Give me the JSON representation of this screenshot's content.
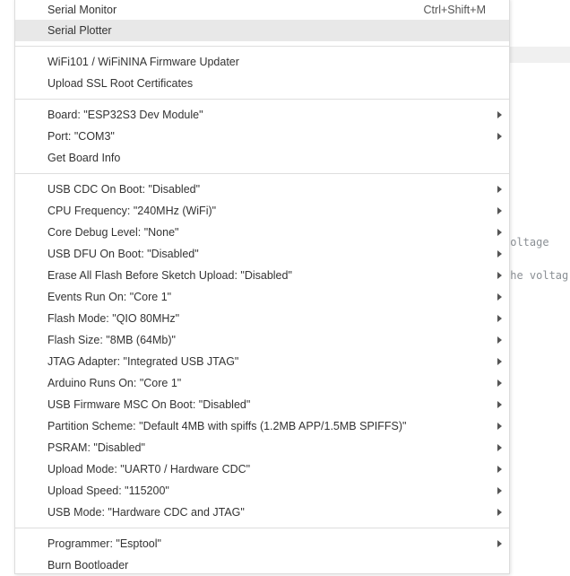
{
  "editor": {
    "code_lines": [
      " voltage",
      "the voltag"
    ]
  },
  "menu": {
    "items": [
      {
        "label": "Serial Monitor",
        "shortcut": "Ctrl+Shift+M"
      },
      {
        "label": "Serial Plotter",
        "shortcut": ""
      },
      {
        "label": "WiFi101 / WiFiNINA Firmware Updater",
        "shortcut": ""
      },
      {
        "label": "Upload SSL Root Certificates",
        "shortcut": ""
      },
      {
        "label": "Board: \"ESP32S3 Dev Module\"",
        "submenu": true
      },
      {
        "label": "Port: \"COM3\"",
        "submenu": true
      },
      {
        "label": "Get Board Info"
      },
      {
        "label": "USB CDC On Boot: \"Disabled\"",
        "submenu": true
      },
      {
        "label": "CPU Frequency: \"240MHz (WiFi)\"",
        "submenu": true
      },
      {
        "label": "Core Debug Level: \"None\"",
        "submenu": true
      },
      {
        "label": "USB DFU On Boot: \"Disabled\"",
        "submenu": true
      },
      {
        "label": "Erase All Flash Before Sketch Upload: \"Disabled\"",
        "submenu": true
      },
      {
        "label": "Events Run On: \"Core 1\"",
        "submenu": true
      },
      {
        "label": "Flash Mode: \"QIO 80MHz\"",
        "submenu": true
      },
      {
        "label": "Flash Size: \"8MB (64Mb)\"",
        "submenu": true
      },
      {
        "label": "JTAG Adapter: \"Integrated USB JTAG\"",
        "submenu": true
      },
      {
        "label": "Arduino Runs On: \"Core 1\"",
        "submenu": true
      },
      {
        "label": "USB Firmware MSC On Boot: \"Disabled\"",
        "submenu": true
      },
      {
        "label": "Partition Scheme: \"Default 4MB with spiffs (1.2MB APP/1.5MB SPIFFS)\"",
        "submenu": true
      },
      {
        "label": "PSRAM: \"Disabled\"",
        "submenu": true
      },
      {
        "label": "Upload Mode: \"UART0 / Hardware CDC\"",
        "submenu": true
      },
      {
        "label": "Upload Speed: \"115200\"",
        "submenu": true
      },
      {
        "label": "USB Mode: \"Hardware CDC and JTAG\"",
        "submenu": true
      },
      {
        "label": "Programmer: \"Esptool\"",
        "submenu": true
      },
      {
        "label": "Burn Bootloader"
      }
    ],
    "hovered_item": "Serial Plotter"
  }
}
